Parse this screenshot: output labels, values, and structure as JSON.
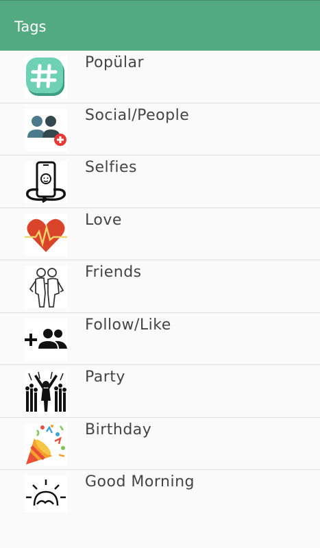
{
  "appbar": {
    "title": "Tags"
  },
  "tags": [
    {
      "label": "Popülar",
      "icon": "hashtag-icon"
    },
    {
      "label": "Social/People",
      "icon": "people-add-icon"
    },
    {
      "label": "Selfies",
      "icon": "selfie-phone-icon"
    },
    {
      "label": "Love",
      "icon": "heart-pulse-icon"
    },
    {
      "label": "Friends",
      "icon": "friends-icon"
    },
    {
      "label": "Follow/Like",
      "icon": "add-group-icon"
    },
    {
      "label": "Party",
      "icon": "party-crowd-icon"
    },
    {
      "label": "Birthday",
      "icon": "party-popper-icon"
    },
    {
      "label": "Good Morning",
      "icon": "sunrise-icon"
    }
  ]
}
